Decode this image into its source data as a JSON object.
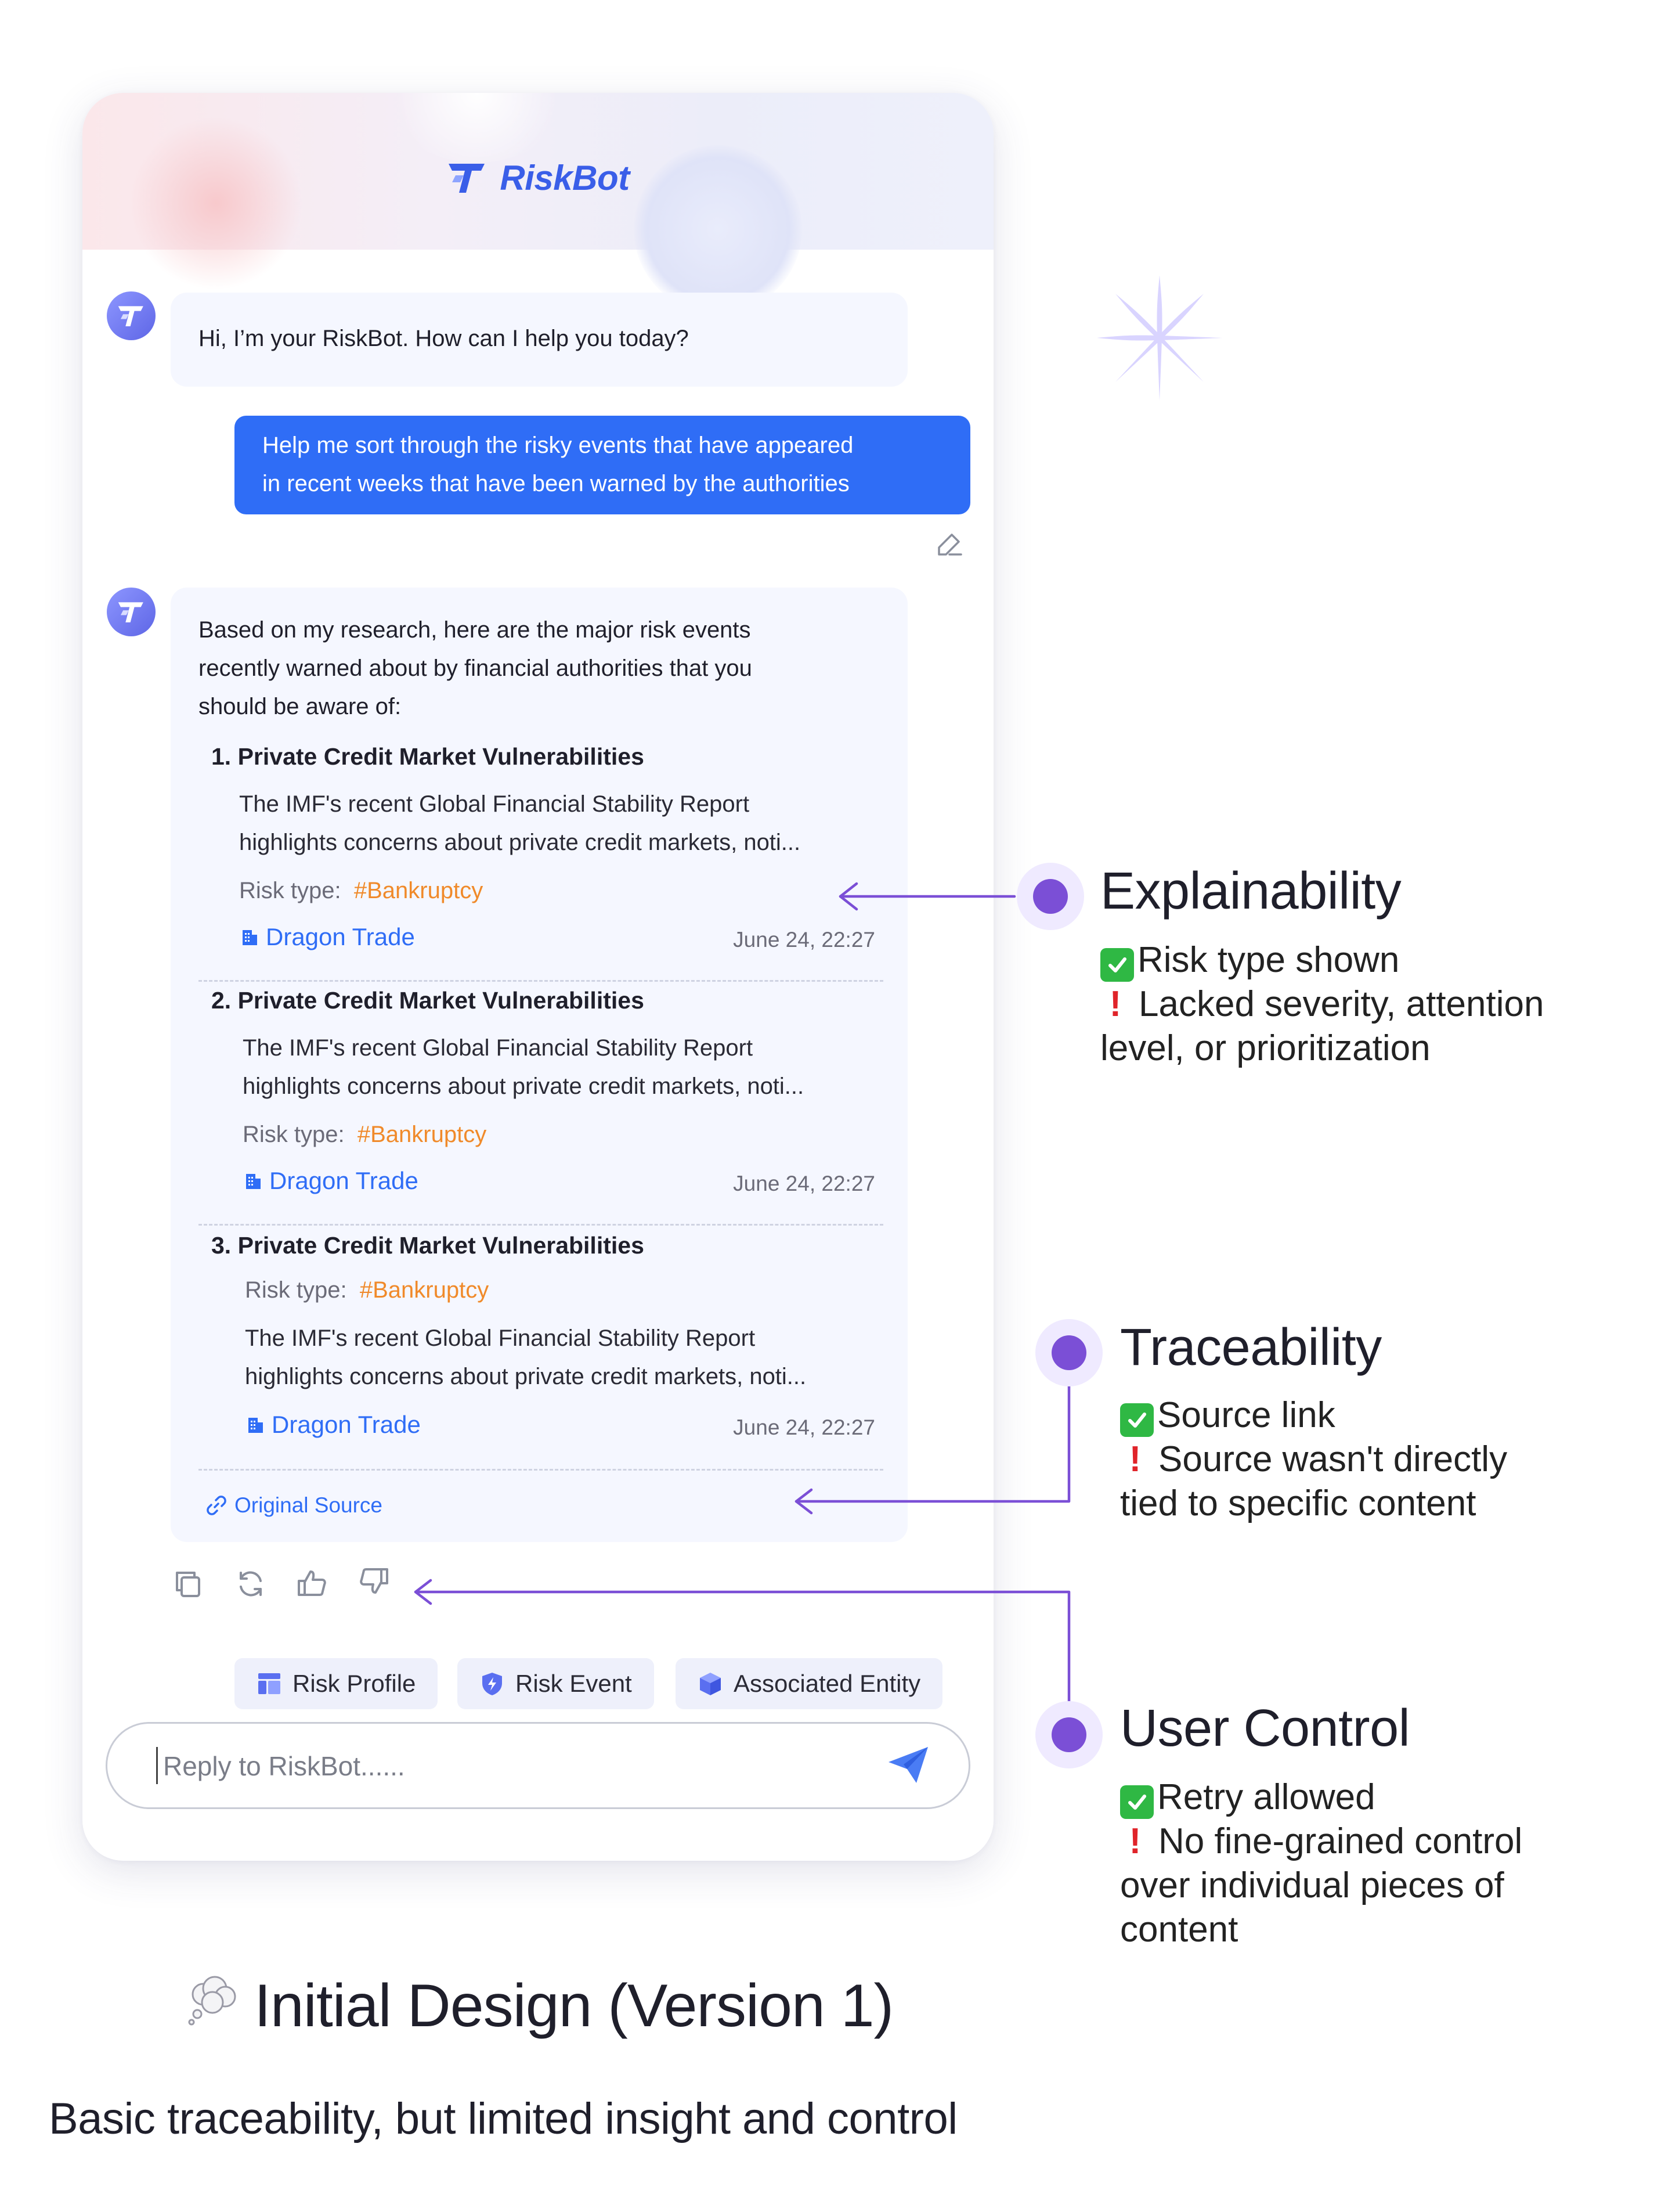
{
  "app": {
    "brand_name": "RiskBot",
    "accent_color": "#2f6df6",
    "annotation_color": "#7b4fd6"
  },
  "chat": {
    "greeting": "Hi, I’m your RiskBot. How can I help you today?",
    "user_message_line1": "Help me sort through the risky events that have appeared",
    "user_message_line2": "in recent weeks that have been warned by the authorities",
    "response_intro_line1": "Based on my research, here are the major risk events",
    "response_intro_line2": "recently warned about by financial authorities that you",
    "response_intro_line3": "should be aware of:",
    "items": [
      {
        "title": "1. Private Credit Market Vulnerabilities",
        "body_line1": "The IMF's recent Global Financial Stability Report",
        "body_line2": "highlights concerns about private credit markets, noti...",
        "risk_label": "Risk type:",
        "risk_tag": "#Bankruptcy",
        "source": "Dragon Trade",
        "timestamp": "June 24, 22:27"
      },
      {
        "title": "2. Private Credit Market Vulnerabilities",
        "body_line1": "The IMF's recent Global Financial Stability Report",
        "body_line2": "highlights concerns about private credit markets, noti...",
        "risk_label": "Risk type:",
        "risk_tag": "#Bankruptcy",
        "source": "Dragon Trade",
        "timestamp": "June 24, 22:27"
      },
      {
        "title": "3. Private Credit Market Vulnerabilities",
        "body_line1": "The IMF's recent Global Financial Stability Report",
        "body_line2": "highlights concerns about private credit markets, noti...",
        "risk_label": "Risk type:",
        "risk_tag": "#Bankruptcy",
        "source": "Dragon Trade",
        "timestamp": "June 24, 22:27"
      }
    ],
    "original_source": "Original Source",
    "chips": [
      "Risk Profile",
      "Risk Event",
      "Associated Entity"
    ],
    "reply_placeholder": "Reply to  RiskBot......"
  },
  "annotations": {
    "explainability": {
      "title": "Explainability",
      "pro": "Risk type shown",
      "con_line1": "Lacked severity, attention",
      "con_line2": "level, or prioritization"
    },
    "traceability": {
      "title": "Traceability",
      "pro": "Source link",
      "con_line1": "Source wasn't directly",
      "con_line2": "tied to specific content"
    },
    "user_control": {
      "title": "User Control",
      "pro": "Retry allowed",
      "con_line1": "No fine-grained control",
      "con_line2": "over individual pieces of",
      "con_line3": "content"
    }
  },
  "footer": {
    "title": "Initial Design (Version 1)",
    "subtitle": "Basic traceability, but limited insight and control"
  }
}
